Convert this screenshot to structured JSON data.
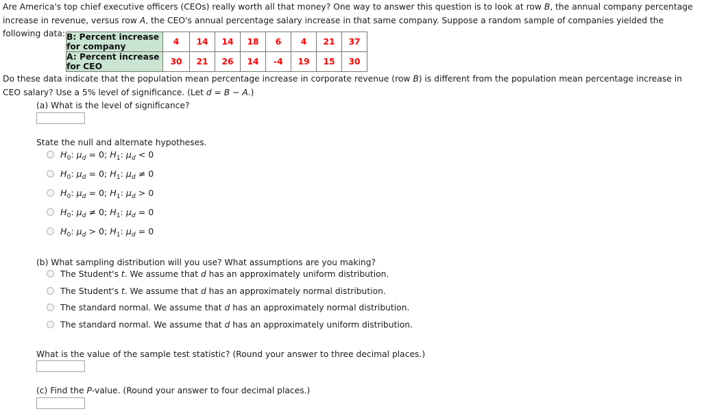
{
  "intro": {
    "text": "Are America's top chief executive officers (CEOs) really worth all that money? One way to answer this question is to look at row B, the annual company percentage increase in revenue, versus row A, the CEO's annual percentage salary increase in that same company. Suppose a random sample of companies yielded the following data:"
  },
  "table": {
    "row_b_label_line1": "B: Percent increase",
    "row_b_label_line2": "for company",
    "row_a_label_line1": "A: Percent increase",
    "row_a_label_line2": "for CEO",
    "row_b_values": [
      "4",
      "14",
      "14",
      "18",
      "6",
      "4",
      "21",
      "37"
    ],
    "row_a_values": [
      "30",
      "21",
      "26",
      "14",
      "-4",
      "19",
      "15",
      "30"
    ],
    "header_color": "#c9e5d2",
    "value_color": "#ff0000",
    "border_color": "#77776f"
  },
  "question": {
    "text": "Do these data indicate that the population mean percentage increase in corporate revenue (row B) is different from the population mean percentage increase in CEO salary? Use a 5% level of significance. (Let d = B − A.)"
  },
  "part_a": {
    "prompt": "(a) What is the level of significance?",
    "input_value": "",
    "hypotheses_prompt": "State the null and alternate hypotheses.",
    "options": [
      "H0: μd = 0; H1: μd < 0",
      "H0: μd = 0; H1: μd ≠ 0",
      "H0: μd = 0; H1: μd > 0",
      "H0: μd ≠ 0; H1: μd = 0",
      "H0: μd > 0; H1: μd = 0"
    ]
  },
  "part_b": {
    "prompt": "(b) What sampling distribution will you use? What assumptions are you making?",
    "options": [
      "The Student's t. We assume that d has an approximately uniform distribution.",
      "The Student's t. We assume that d has an approximately normal distribution.",
      "The standard normal. We assume that d has an approximately normal distribution.",
      "The standard normal. We assume that d has an approximately uniform distribution."
    ],
    "test_statistic_prompt": "What is the value of the sample test statistic? (Round your answer to three decimal places.)",
    "test_statistic_value": ""
  },
  "part_c": {
    "prompt": "(c) Find the P-value. (Round your answer to four decimal places.)",
    "input_value": ""
  }
}
